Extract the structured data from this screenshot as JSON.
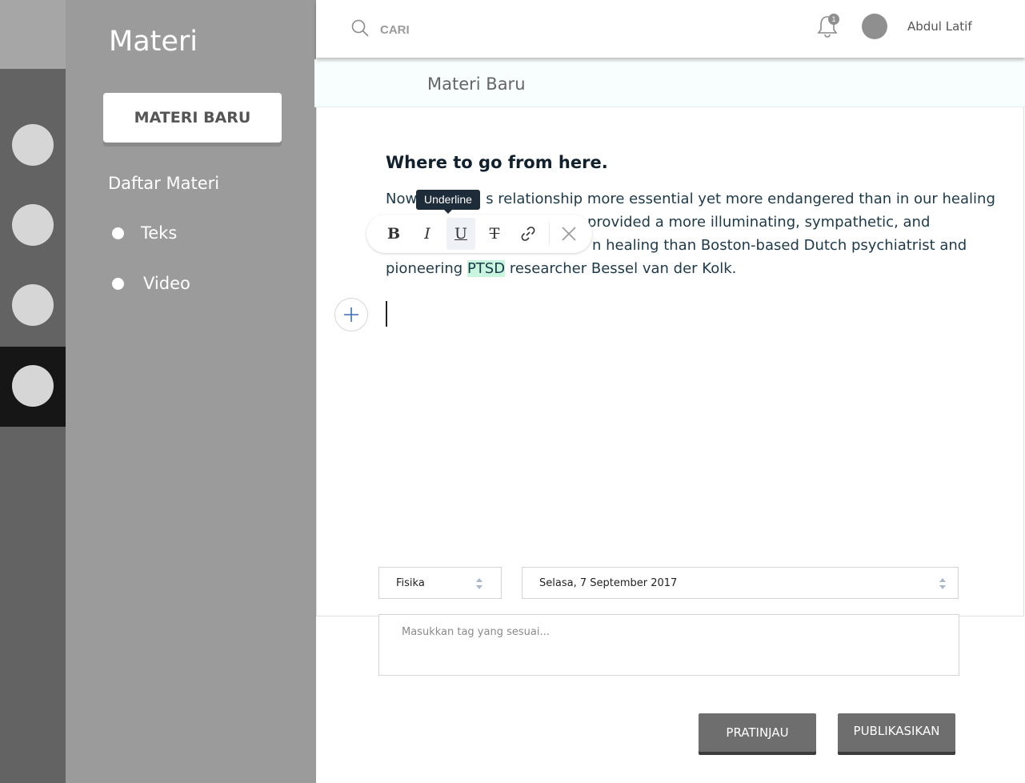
{
  "rail": {
    "items": [
      {
        "name": "rail-item-1",
        "icon": "circle-placeholder-icon"
      },
      {
        "name": "rail-item-2",
        "icon": "circle-placeholder-icon"
      },
      {
        "name": "rail-item-3",
        "icon": "circle-placeholder-icon"
      },
      {
        "name": "rail-item-4",
        "icon": "circle-placeholder-icon",
        "active": true
      }
    ]
  },
  "sidebar": {
    "title": "Materi",
    "new_button": "MATERI BARU",
    "list_heading": "Daftar Materi",
    "items": [
      {
        "label": "Teks"
      },
      {
        "label": "Video"
      }
    ]
  },
  "header": {
    "search_placeholder": "CARI",
    "notification_count": "1",
    "user_name": "Abdul Latif"
  },
  "page": {
    "title": "Materi Baru"
  },
  "editor": {
    "heading": "Where to go from here.",
    "paragraph": {
      "line1_start": "Now",
      "line1_end": "s relationship more essential yet more endangered than in our healing",
      "line2_end": "provided a more illuminating, sympathetic, and",
      "line3_end": "n healing than Boston-based Dutch psychiatrist and",
      "line4_start": "pioneering ",
      "line4_highlight": "PTSD",
      "line4_end": " researcher Bessel van der Kolk."
    },
    "toolbar": {
      "tooltip": "Underline",
      "buttons": [
        "bold-icon",
        "italic-icon",
        "underline-icon",
        "strikethrough-icon",
        "link-icon",
        "close-icon"
      ],
      "active": "underline-icon"
    },
    "add_block_icon": "plus-icon"
  },
  "form": {
    "subject": "Fisika",
    "date": "Selasa, 7 September 2017",
    "tag_placeholder": "Masukkan tag yang sesuai..."
  },
  "actions": {
    "preview": "PRATINJAU",
    "publish": "PUBLIKASIKAN"
  },
  "colors": {
    "rail": "#636363",
    "sidebar": "#9b9b9b",
    "rail_active": "#161616",
    "highlight": "#c7f5de",
    "tooltip": "#1e2b38",
    "action_button": "#6e6e6e"
  }
}
